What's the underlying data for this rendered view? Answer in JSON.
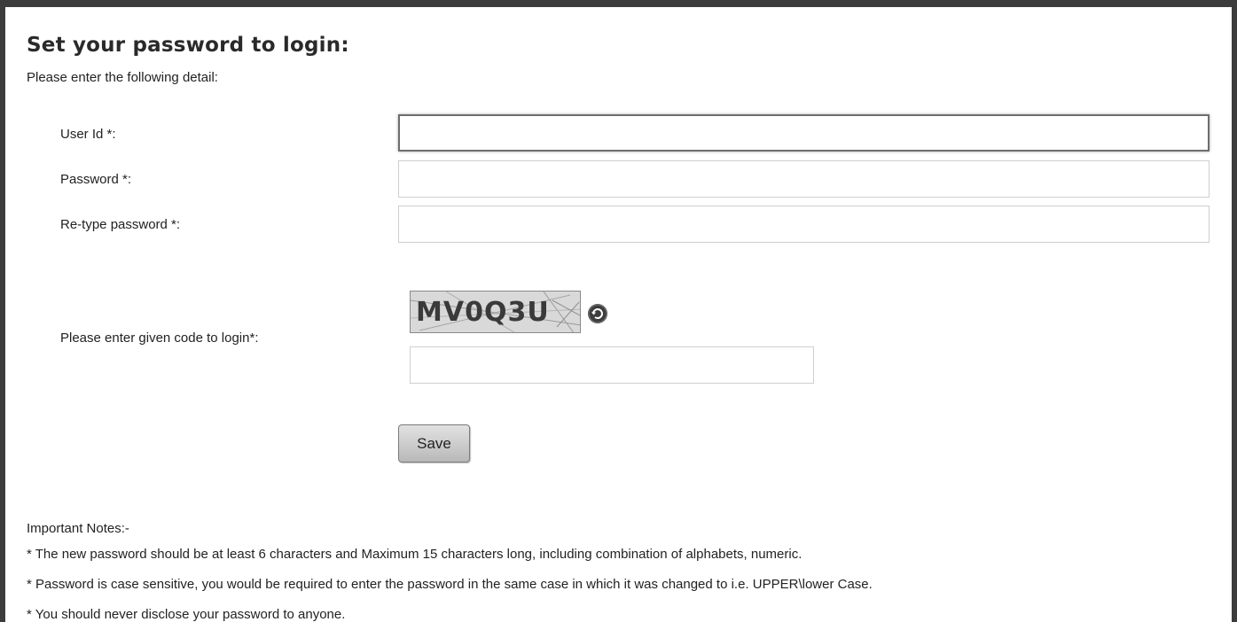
{
  "form": {
    "title": "Set your password to login:",
    "subtitle": "Please enter the following detail:",
    "user_id_label": "User Id *:",
    "user_id_value": "",
    "password_label": "Password *:",
    "password_value": "",
    "retype_label": "Re-type password *:",
    "retype_value": "",
    "captcha_label": "Please enter given code to login*:",
    "captcha_code": "MV0Q3U",
    "captcha_value": "",
    "save_label": "Save"
  },
  "notes": {
    "heading": "Important Notes:-",
    "items": [
      "* The new password should be at least 6 characters and Maximum 15 characters long, including combination of alphabets, numeric.",
      "* Password is case sensitive, you would be required to enter the password in the same case in which it was changed to i.e. UPPER\\lower Case.",
      "* You should never disclose your password to anyone."
    ]
  },
  "icons": {
    "captcha_refresh": "refresh-icon"
  }
}
